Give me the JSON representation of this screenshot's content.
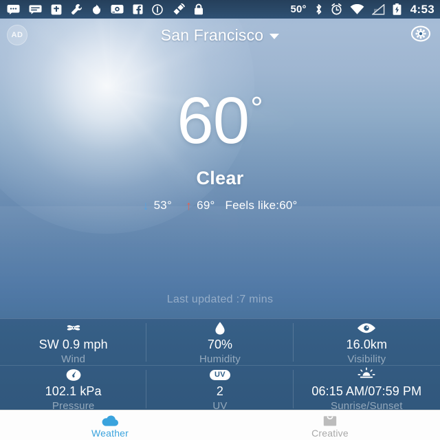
{
  "status_bar": {
    "icons_left": [
      {
        "name": "messages-icon",
        "glyph": "…"
      },
      {
        "name": "sms-icon",
        "glyph": "▬"
      },
      {
        "name": "download-icon",
        "glyph": "⬆"
      },
      {
        "name": "wrench-icon",
        "glyph": "🔧"
      },
      {
        "name": "firefox-icon",
        "glyph": "฿"
      },
      {
        "name": "screenshot-icon",
        "glyph": "🖥"
      },
      {
        "name": "facebook-icon",
        "glyph": "f"
      },
      {
        "name": "info-icon",
        "glyph": "ⓘ"
      },
      {
        "name": "gps-satellite-icon",
        "glyph": "🛰"
      },
      {
        "name": "lock-icon",
        "glyph": "🔒"
      }
    ],
    "temperature": "50°",
    "icons_right": [
      {
        "name": "bluetooth-icon",
        "glyph": "ᛦ"
      },
      {
        "name": "alarm-icon",
        "glyph": "⏰"
      },
      {
        "name": "wifi-icon",
        "glyph": "▼"
      },
      {
        "name": "signal-icon",
        "glyph": "◥"
      },
      {
        "name": "battery-charging-icon",
        "glyph": "⚡"
      }
    ],
    "clock": "4:53"
  },
  "header": {
    "ad_badge_label": "AD",
    "city": "San Francisco",
    "settings_label": "Settings"
  },
  "current": {
    "temperature": "60",
    "degree_symbol": "°",
    "condition": "Clear",
    "low_arrow": "↓",
    "low": "53°",
    "high_arrow": "↑",
    "high": "69°",
    "feels_like": "Feels like:60°",
    "last_updated": "Last updated :7 mins"
  },
  "metrics": [
    {
      "icon": "wind-fan-icon",
      "value": "SW 0.9 mph",
      "label": "Wind"
    },
    {
      "icon": "water-drop-icon",
      "value": "70%",
      "label": "Humidity"
    },
    {
      "icon": "eye-icon",
      "value": "16.0km",
      "label": "Visibility"
    },
    {
      "icon": "gauge-icon",
      "value": "102.1 kPa",
      "label": "Pressure"
    },
    {
      "icon": "uv-pill-icon",
      "icon_text": "UV",
      "value": "2",
      "label": "UV"
    },
    {
      "icon": "sunrise-sunset-icon",
      "value": "06:15 AM/07:59 PM",
      "label": "Sunrise/Sunset"
    }
  ],
  "tabbar": {
    "tabs": [
      {
        "icon": "cloud-icon",
        "label": "Weather",
        "active": true
      },
      {
        "icon": "shopping-bag-icon",
        "label": "Creative",
        "active": false
      }
    ]
  },
  "colors": {
    "accent": "#3aa3dd",
    "inactive": "#a8a8a8",
    "low_arrow": "#55a2e0",
    "high_arrow": "#e8604f",
    "panel": "rgba(17,54,88,0.30)",
    "status_bar": "#2b4a69"
  }
}
